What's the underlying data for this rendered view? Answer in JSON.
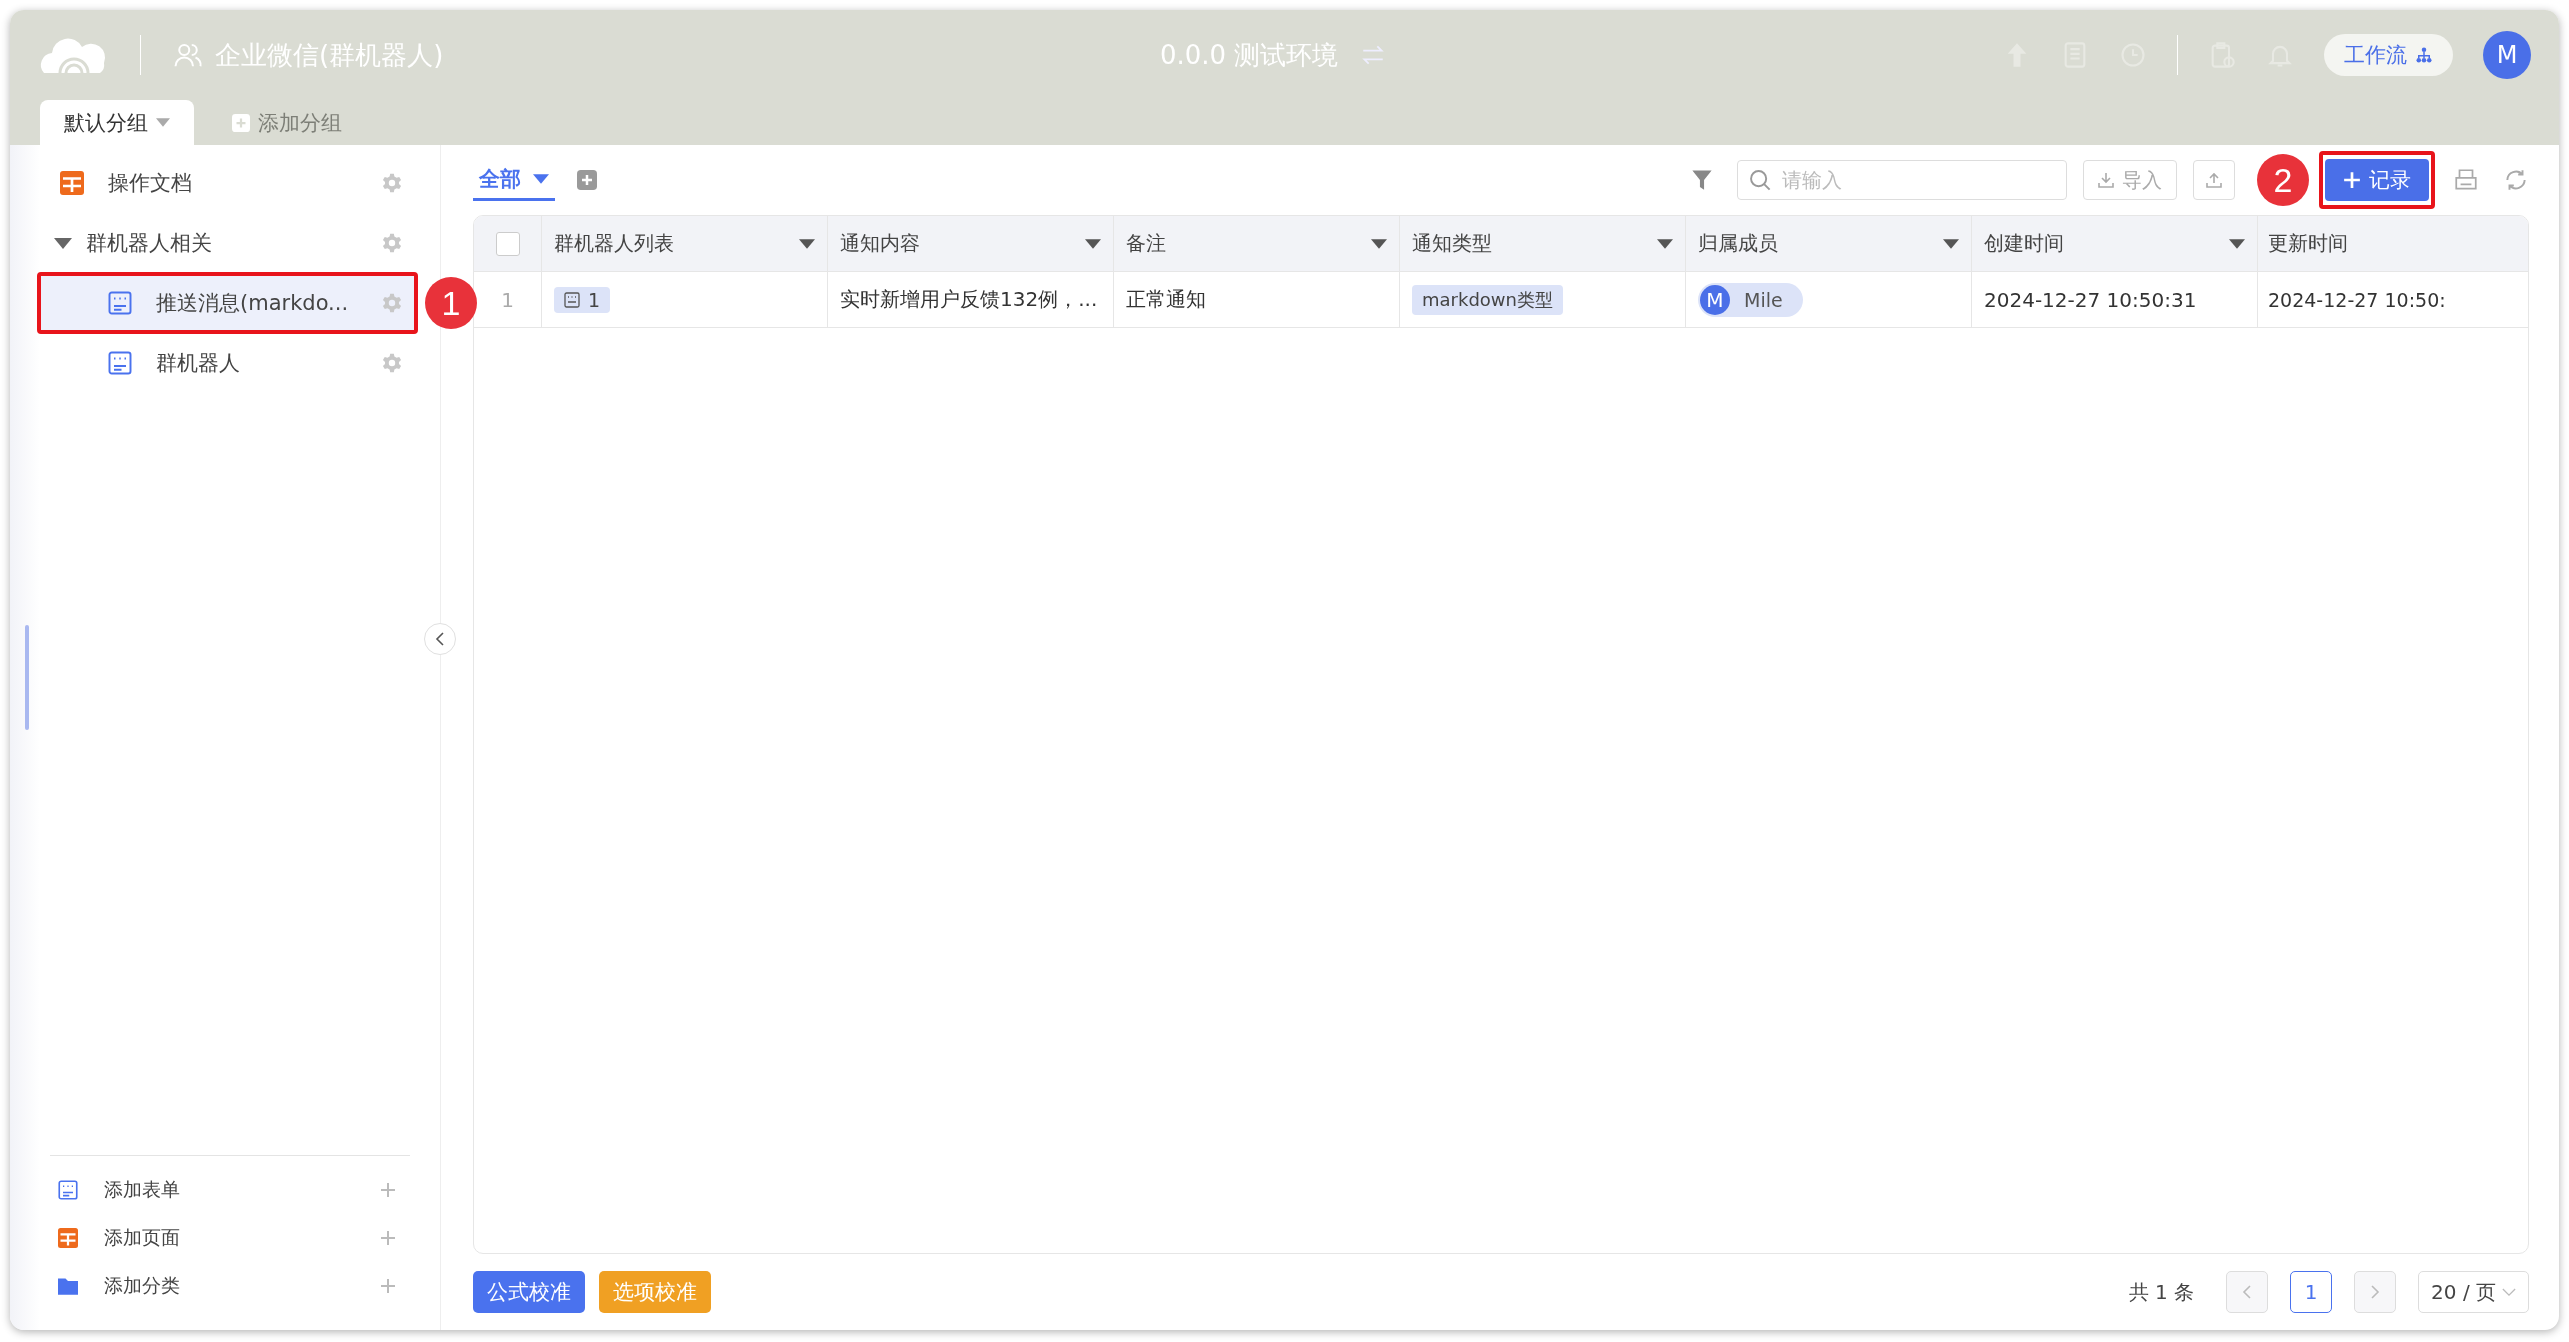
{
  "header": {
    "title": "企业微信(群机器人)",
    "environment": "0.0.0 测试环境",
    "workflow_button": "工作流",
    "avatar": "M"
  },
  "group_tabs": [
    {
      "label": "默认分组",
      "selected": true,
      "kind": "group"
    },
    {
      "label": "添加分组",
      "selected": false,
      "kind": "add"
    }
  ],
  "sidebar": {
    "items": [
      {
        "label": "操作文档",
        "kind": "page",
        "selected": false
      },
      {
        "label": "群机器人相关",
        "kind": "folder",
        "selected": false,
        "expanded": true,
        "children": [
          {
            "label": "推送消息(markdo...",
            "kind": "form",
            "selected": true,
            "callout": "1"
          },
          {
            "label": "群机器人",
            "kind": "form",
            "selected": false
          }
        ]
      }
    ],
    "actions": [
      {
        "label": "添加表单",
        "kind": "form"
      },
      {
        "label": "添加页面",
        "kind": "page"
      },
      {
        "label": "添加分类",
        "kind": "folder"
      }
    ]
  },
  "view_tabs": [
    {
      "label": "全部",
      "selected": true
    }
  ],
  "toolbar": {
    "search": {
      "placeholder": "请输入"
    },
    "import_button": "导入",
    "add_button": {
      "label": "记录",
      "callout": "2"
    }
  },
  "table": {
    "select_all": {
      "checked": false
    },
    "columns": [
      "群机器人列表",
      "通知内容",
      "备注",
      "通知类型",
      "归属成员",
      "创建时间",
      "更新时间"
    ],
    "rows": [
      {
        "number": "1",
        "selected": false,
        "cells": [
          {
            "kind": "link",
            "text": "1"
          },
          {
            "kind": "text",
            "text": "实时新增用户反馈132例，..."
          },
          {
            "kind": "text",
            "text": "正常通知"
          },
          {
            "kind": "tag",
            "text": "markdown类型"
          },
          {
            "kind": "member",
            "avatar": "M",
            "text": "Mile"
          },
          {
            "kind": "text",
            "text": "2024-12-27 10:50:31"
          },
          {
            "kind": "text",
            "text": "2024-12-27 10:50:"
          }
        ]
      }
    ]
  },
  "footer": {
    "buttons": [
      {
        "label": "公式校准",
        "color": "#4a72ee"
      },
      {
        "label": "选项校准",
        "color": "#f0a023"
      }
    ],
    "total": "共 1 条",
    "pages": [
      {
        "label": "1",
        "selected": true
      }
    ],
    "page_size": "20 / 页"
  }
}
